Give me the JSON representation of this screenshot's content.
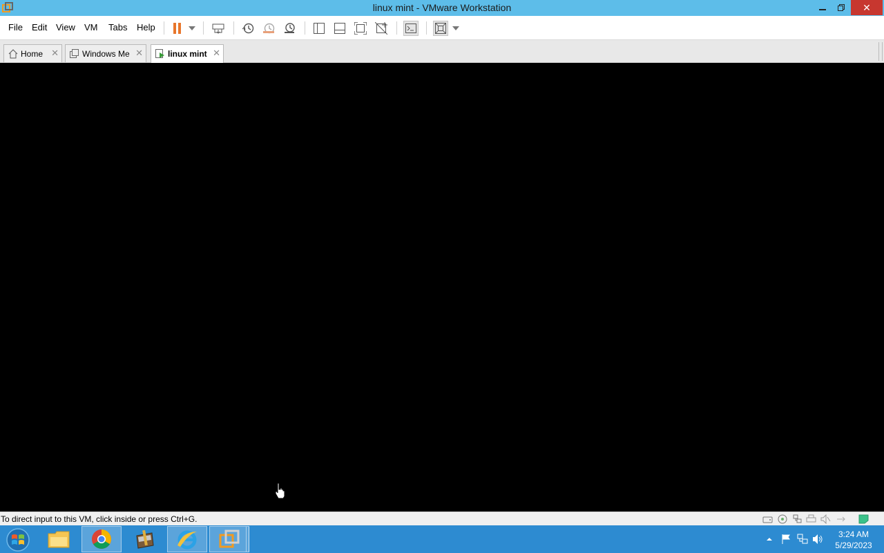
{
  "window": {
    "title": "linux mint - VMware Workstation"
  },
  "menu": {
    "items": [
      "File",
      "Edit",
      "View",
      "VM",
      "Tabs",
      "Help"
    ]
  },
  "tabs": [
    {
      "label": "Home",
      "active": false
    },
    {
      "label": "Windows Me",
      "active": false
    },
    {
      "label": "linux mint",
      "active": true
    }
  ],
  "status": {
    "message": "To direct input to this VM, click inside or press Ctrl+G."
  },
  "taskbar": {
    "apps": [
      "file-explorer",
      "chrome",
      "archive-manager",
      "internet-explorer",
      "vmware-workstation"
    ],
    "clock_time": "3:24 AM",
    "clock_date": "5/29/2023"
  },
  "colors": {
    "titlebar": "#5dbde9",
    "pause_accent": "#e8762b",
    "taskbar": "#2d8bd1",
    "close_button": "#c7372f"
  }
}
